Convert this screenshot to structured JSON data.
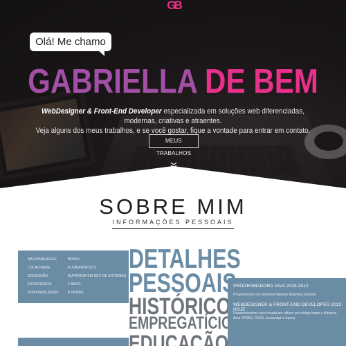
{
  "hero": {
    "logo": "GB",
    "greeting": "Olá! Me chamo",
    "name_first": "GABRIELLA",
    "name_last": "DE BEM",
    "description_strong": "WebDesigner & Front-End Developer",
    "description_line1": " especializada em soluções web diferenciadas, modernas, criativas e atraentes.",
    "description_line2": "Veja alguns dos meus trabalhos, e se você gostar, fique a vontade para entrar em contato.",
    "cta_label": "MEUS TRABALHOS",
    "scroll_icon": "double-chevron-down-icon",
    "accent_pink": "#e8318a",
    "accent_purple": "#a24fa6"
  },
  "about": {
    "title": "SOBRE MIM",
    "subtitle": "INFORMAÇÕES PESSOAIS"
  },
  "details": {
    "rows": [
      {
        "label": "NACIONALIDADE",
        "value": "BRASIL"
      },
      {
        "label": "LOCALIDADE",
        "value": "FLORIANÓPOLIS"
      },
      {
        "label": "EDUCAÇÃO",
        "value": "SUPERIOR EM DEV DE SISTEMAS"
      },
      {
        "label": "EXPERIENCIA",
        "value": "5 ANOS"
      },
      {
        "label": "DISPONIBILIDADE",
        "value": "8 HORAS"
      }
    ],
    "headings": [
      "DETALHES",
      "PESSOAIS",
      "HISTÓRICO",
      "EMPREGATÍCIO",
      "EDUCAÇÃO"
    ],
    "jobs": [
      {
        "title": "PROGRAMADORA JAVA 2010-2012",
        "text": "Programadora na empresa Neoway Business Solution"
      },
      {
        "title": "WEBDESIGNER & FRONT-END DEVELOPER 2012-HOJE",
        "text": "Desenvolvedora web focada em utilizar um código limpo e eficiente. Ama HTML5, CSS3, Javascript e Jquery"
      }
    ],
    "panel_color": "#6b8ca5"
  }
}
